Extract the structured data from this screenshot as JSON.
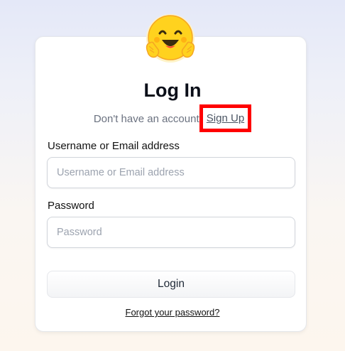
{
  "logo": {
    "icon": "hugging-face-emoji-icon"
  },
  "heading": {
    "title": "Log In"
  },
  "signup": {
    "prompt": "Don't have an account",
    "link_label": "Sign Up",
    "highlight_color": "#ff0000"
  },
  "form": {
    "username_label": "Username or Email address",
    "username_placeholder": "Username or Email address",
    "username_value": "",
    "password_label": "Password",
    "password_placeholder": "Password",
    "password_value": ""
  },
  "actions": {
    "login_label": "Login",
    "forgot_label": "Forgot your password?"
  }
}
